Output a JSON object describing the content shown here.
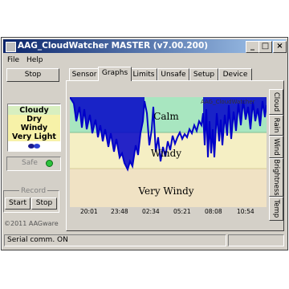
{
  "window": {
    "title": "AAG_CloudWatcher MASTER (v7.00.200)",
    "minimize_label": "_",
    "maximize_label": "□",
    "close_label": "×"
  },
  "menu": {
    "file": "File",
    "help": "Help"
  },
  "left_panel": {
    "stop_label": "Stop",
    "conditions": [
      "Cloudy",
      "Dry",
      "Windy",
      "Very Light"
    ],
    "safe_label": "Safe",
    "record_label": "Record",
    "record_start": "Start",
    "record_stop": "Stop",
    "copyright": "©2011 AAGware"
  },
  "tabs": [
    "Sensor",
    "Graphs",
    "Limits",
    "Unsafe",
    "Setup",
    "Device"
  ],
  "side_tabs": [
    "Cloud",
    "Rain",
    "Wind",
    "Brightness",
    "Temp"
  ],
  "graph": {
    "legend": "AAG_CloudWatcher",
    "zones": [
      "Calm",
      "Windy",
      "Very Windy"
    ],
    "time_labels": [
      "20:01",
      "23:48",
      "02:34",
      "05:21",
      "08:08",
      "10:54"
    ],
    "colors": {
      "calm": "#a8e6c0",
      "windy": "#f5efc4",
      "very_windy": "#f0e2c4",
      "line": "#0000c8"
    }
  },
  "status_bar": {
    "text": "Serial comm. ON"
  },
  "colors": {
    "title_start": "#0a246a",
    "title_end": "#a6caf0",
    "cloudy": "#d8efc0",
    "dry": "#f7f2a8",
    "windy": "#f7f2a8",
    "very_light": "#f7f2a8",
    "safe_led": "#2cc23c"
  }
}
